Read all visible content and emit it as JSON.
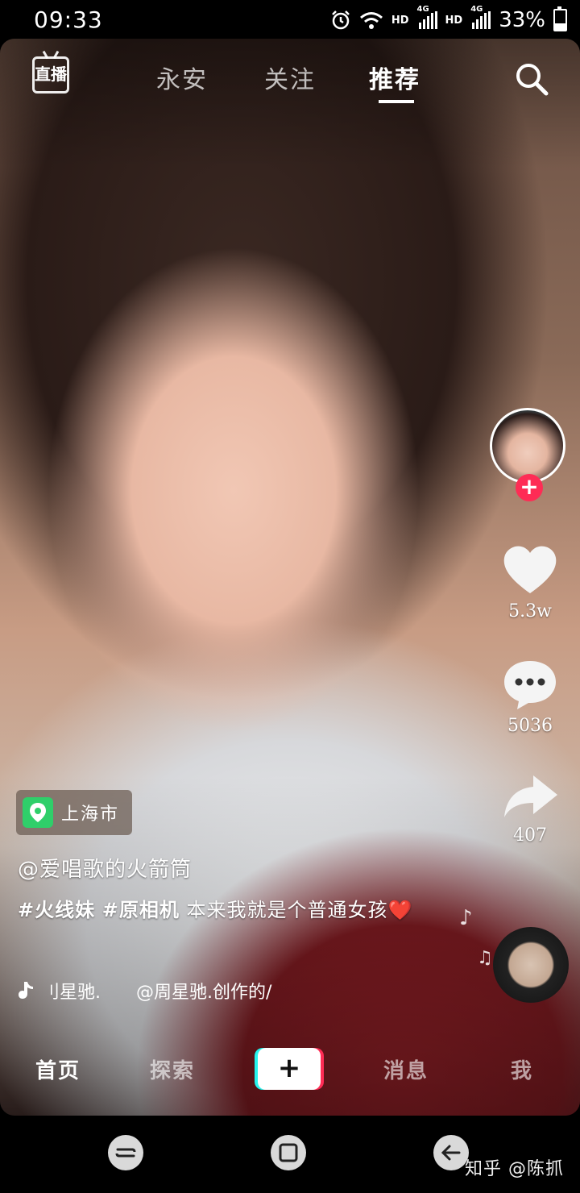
{
  "status_bar": {
    "time": "09:33",
    "hd_1": "HD",
    "net_1": "4G",
    "hd_2": "HD",
    "net_2": "4G",
    "battery": "33%",
    "battery_level": 0.33
  },
  "top_nav": {
    "live_label": "直播",
    "tabs": [
      {
        "label": "永安"
      },
      {
        "label": "关注"
      },
      {
        "label": "推荐"
      }
    ],
    "active_tab": "推荐"
  },
  "side_actions": {
    "like_count": "5.3w",
    "comment_count": "5036",
    "share_count": "407"
  },
  "post": {
    "location": "上海市",
    "username": "@爱唱歌的火箭筒",
    "hashtag_1": "#火线妹",
    "hashtag_2": "#原相机",
    "caption_text": "本来我就是个普通女孩",
    "caption_emoji": "❤️",
    "music_text": "刂星驰.　　@周星驰.创作的/"
  },
  "bottom_tabs": {
    "home": "首页",
    "explore": "探索",
    "create": "+",
    "messages": "消息",
    "me": "我"
  },
  "watermark": "知乎 @陈抓",
  "colors": {
    "accent_red": "#fe2c55",
    "accent_cyan": "#25f4ee",
    "location_green": "#2fcf6a"
  }
}
